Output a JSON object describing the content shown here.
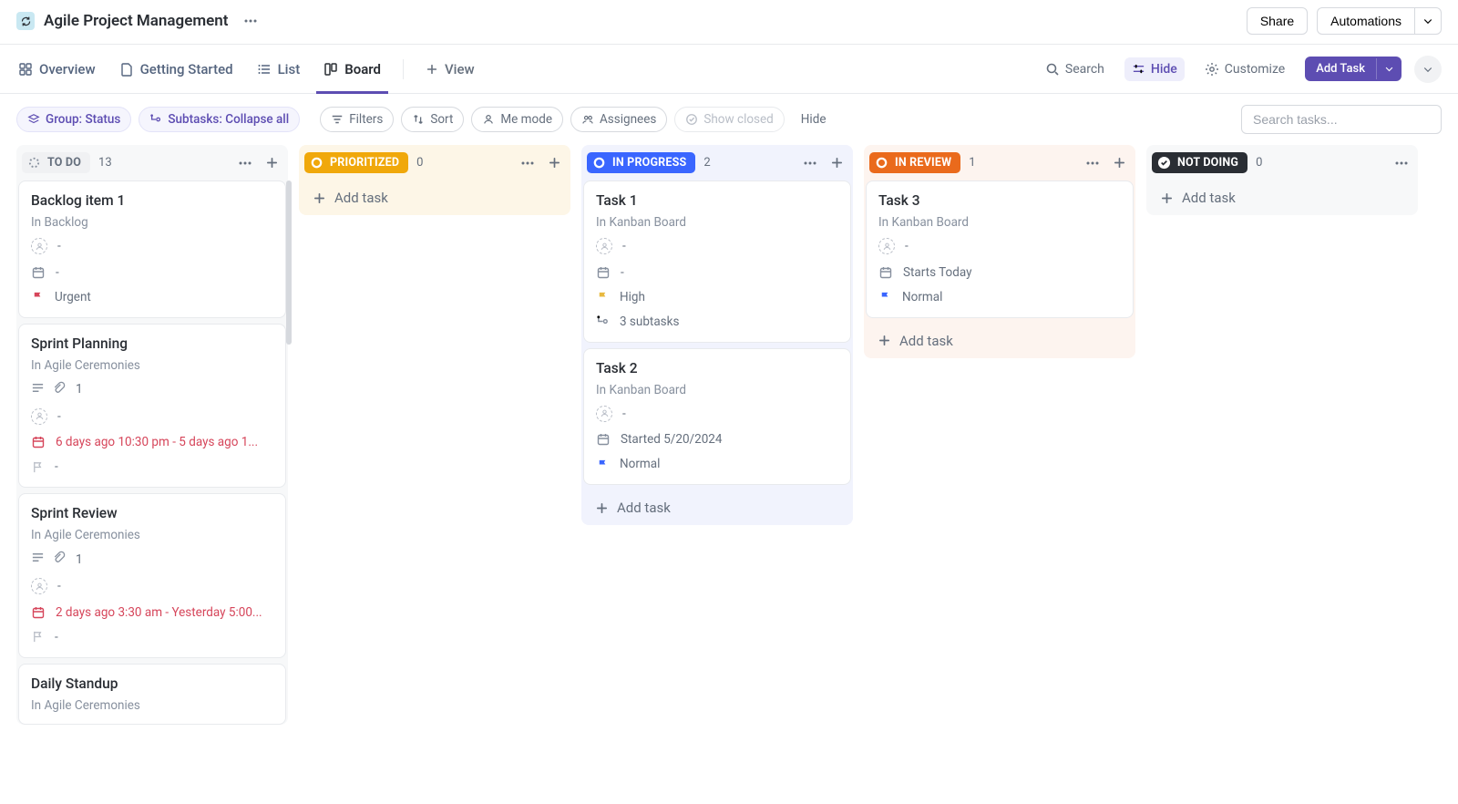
{
  "header": {
    "title": "Agile Project Management",
    "share": "Share",
    "automations": "Automations"
  },
  "views": {
    "overview": "Overview",
    "getting_started": "Getting Started",
    "list": "List",
    "board": "Board",
    "add_view": "View"
  },
  "toolbar": {
    "search": "Search",
    "hide": "Hide",
    "customize": "Customize",
    "add_task": "Add Task"
  },
  "filters": {
    "group": "Group: Status",
    "subtasks": "Subtasks: Collapse all",
    "filters": "Filters",
    "sort": "Sort",
    "me_mode": "Me mode",
    "assignees": "Assignees",
    "show_closed": "Show closed",
    "hide": "Hide",
    "search_placeholder": "Search tasks..."
  },
  "actions": {
    "add_task": "Add task"
  },
  "columns": [
    {
      "key": "todo",
      "name": "TO DO",
      "count": "13",
      "class": "col-todo",
      "cards": [
        {
          "title": "Backlog item 1",
          "sub": "In Backlog",
          "rows": [
            {
              "icon": "person",
              "text": "-"
            },
            {
              "icon": "calendar",
              "text": "-"
            },
            {
              "icon": "flag",
              "text": "Urgent",
              "flagColor": "#d6455a"
            }
          ]
        },
        {
          "title": "Sprint Planning",
          "sub": "In Agile Ceremonies",
          "rows": [
            {
              "icon": "docattach",
              "text": "1"
            },
            {
              "icon": "person",
              "text": "-"
            },
            {
              "icon": "calendar",
              "text": "6 days ago 10:30 pm - 5 days ago 1...",
              "red": true
            },
            {
              "icon": "flag",
              "text": "-",
              "flagColor": "#b9bec7"
            }
          ]
        },
        {
          "title": "Sprint Review",
          "sub": "In Agile Ceremonies",
          "rows": [
            {
              "icon": "docattach",
              "text": "1"
            },
            {
              "icon": "person",
              "text": "-"
            },
            {
              "icon": "calendar",
              "text": "2 days ago 3:30 am - Yesterday 5:00...",
              "red": true
            },
            {
              "icon": "flag",
              "text": "-",
              "flagColor": "#b9bec7"
            }
          ]
        },
        {
          "title": "Daily Standup",
          "sub": "In Agile Ceremonies",
          "rows": []
        }
      ]
    },
    {
      "key": "prioritized",
      "name": "PRIORITIZED",
      "count": "0",
      "class": "col-prio",
      "cards": []
    },
    {
      "key": "in_progress",
      "name": "IN PROGRESS",
      "count": "2",
      "class": "col-prog",
      "cards": [
        {
          "title": "Task 1",
          "sub": "In Kanban Board",
          "rows": [
            {
              "icon": "person",
              "text": "-"
            },
            {
              "icon": "calendar",
              "text": "-"
            },
            {
              "icon": "flag",
              "text": "High",
              "flagColor": "#e8b93f"
            },
            {
              "icon": "subtask",
              "text": "3 subtasks"
            }
          ]
        },
        {
          "title": "Task 2",
          "sub": "In Kanban Board",
          "rows": [
            {
              "icon": "person",
              "text": "-"
            },
            {
              "icon": "calendar",
              "text": "Started 5/20/2024"
            },
            {
              "icon": "flag",
              "text": "Normal",
              "flagColor": "#3a66ff"
            }
          ]
        }
      ]
    },
    {
      "key": "in_review",
      "name": "IN REVIEW",
      "count": "1",
      "class": "col-review",
      "cards": [
        {
          "title": "Task 3",
          "sub": "In Kanban Board",
          "rows": [
            {
              "icon": "person",
              "text": "-"
            },
            {
              "icon": "calendar",
              "text": "Starts Today"
            },
            {
              "icon": "flag",
              "text": "Normal",
              "flagColor": "#3a66ff"
            }
          ]
        }
      ]
    },
    {
      "key": "not_doing",
      "name": "NOT DOING",
      "count": "0",
      "class": "col-notdo",
      "cards": []
    }
  ]
}
